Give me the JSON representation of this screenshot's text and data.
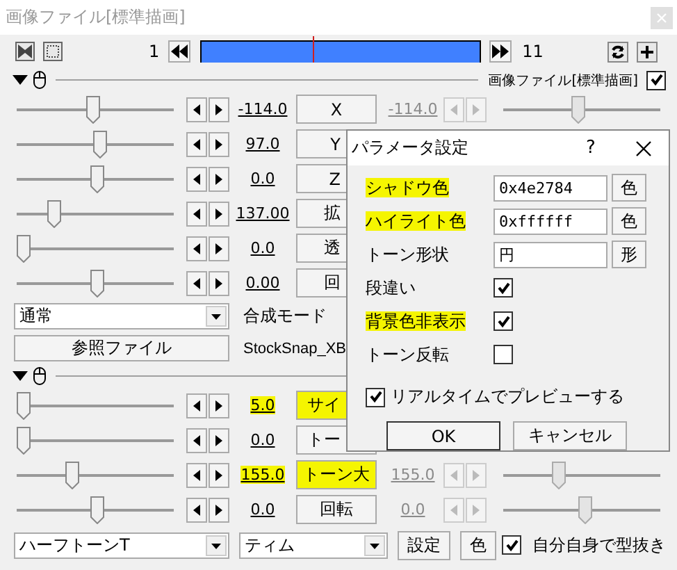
{
  "window": {
    "title": "画像ファイル[標準描画]"
  },
  "toolbar": {
    "start": "1",
    "end": "11",
    "level": 0.4
  },
  "sections": [
    {
      "label": "画像ファイル[標準描画]",
      "checked": true,
      "tracks": [
        {
          "value": "-114.0",
          "label": "X",
          "level": 0.49,
          "highlighted": false,
          "right": {
            "value": "-114.0",
            "level": 0.48
          }
        },
        {
          "value": "97.0",
          "label": "Y",
          "level": 0.53,
          "highlighted": false
        },
        {
          "value": "0.0",
          "label": "Z",
          "level": 0.51,
          "highlighted": false
        },
        {
          "value": "137.00",
          "label": "拡",
          "level": 0.21,
          "highlighted": false
        },
        {
          "value": "0.0",
          "label": "透",
          "level": 0.0,
          "highlighted": false
        },
        {
          "value": "0.00",
          "label": "回",
          "level": 0.51,
          "highlighted": false
        }
      ],
      "blend": {
        "mode": "通常",
        "label": "合成モード"
      },
      "file": {
        "button": "参照ファイル",
        "name": "StockSnap_XB"
      }
    },
    {
      "tracks": [
        {
          "value": "5.0",
          "label": "サイ",
          "level": 0.0,
          "highlighted": true
        },
        {
          "value": "0.0",
          "label": "トー",
          "level": 0.0,
          "highlighted": false
        },
        {
          "value": "155.0",
          "label": "トーン大",
          "level": 0.34,
          "highlighted": true,
          "right": {
            "value": "155.0",
            "level": 0.34
          }
        },
        {
          "value": "0.0",
          "label": "回転",
          "level": 0.51,
          "highlighted": false,
          "right": {
            "value": "0.0",
            "level": 0.52
          }
        }
      ],
      "filter": {
        "effect": "ハーフトーンT",
        "preset": "ティム",
        "settings": "設定",
        "color_button": "色",
        "self_cut": {
          "label": "自分自身で型抜き",
          "checked": true
        }
      }
    }
  ],
  "dialog": {
    "title": "パラメータ設定",
    "help": "?",
    "rows": [
      {
        "kind": "field",
        "label": "シャドウ色",
        "value": "0x4e2784",
        "button": "色",
        "highlighted": true
      },
      {
        "kind": "field",
        "label": "ハイライト色",
        "value": "0xffffff",
        "button": "色",
        "highlighted": true
      },
      {
        "kind": "field",
        "label": "トーン形状",
        "value": "円",
        "button": "形",
        "highlighted": false
      },
      {
        "kind": "checkbox",
        "label": "段違い",
        "checked": true,
        "highlighted": false
      },
      {
        "kind": "checkbox",
        "label": "背景色非表示",
        "checked": true,
        "highlighted": true
      },
      {
        "kind": "checkbox",
        "label": "トーン反転",
        "checked": false,
        "highlighted": false
      }
    ],
    "preview": {
      "label": "リアルタイムでプレビューする",
      "checked": true
    },
    "ok": "OK",
    "cancel": "キャンセル"
  }
}
